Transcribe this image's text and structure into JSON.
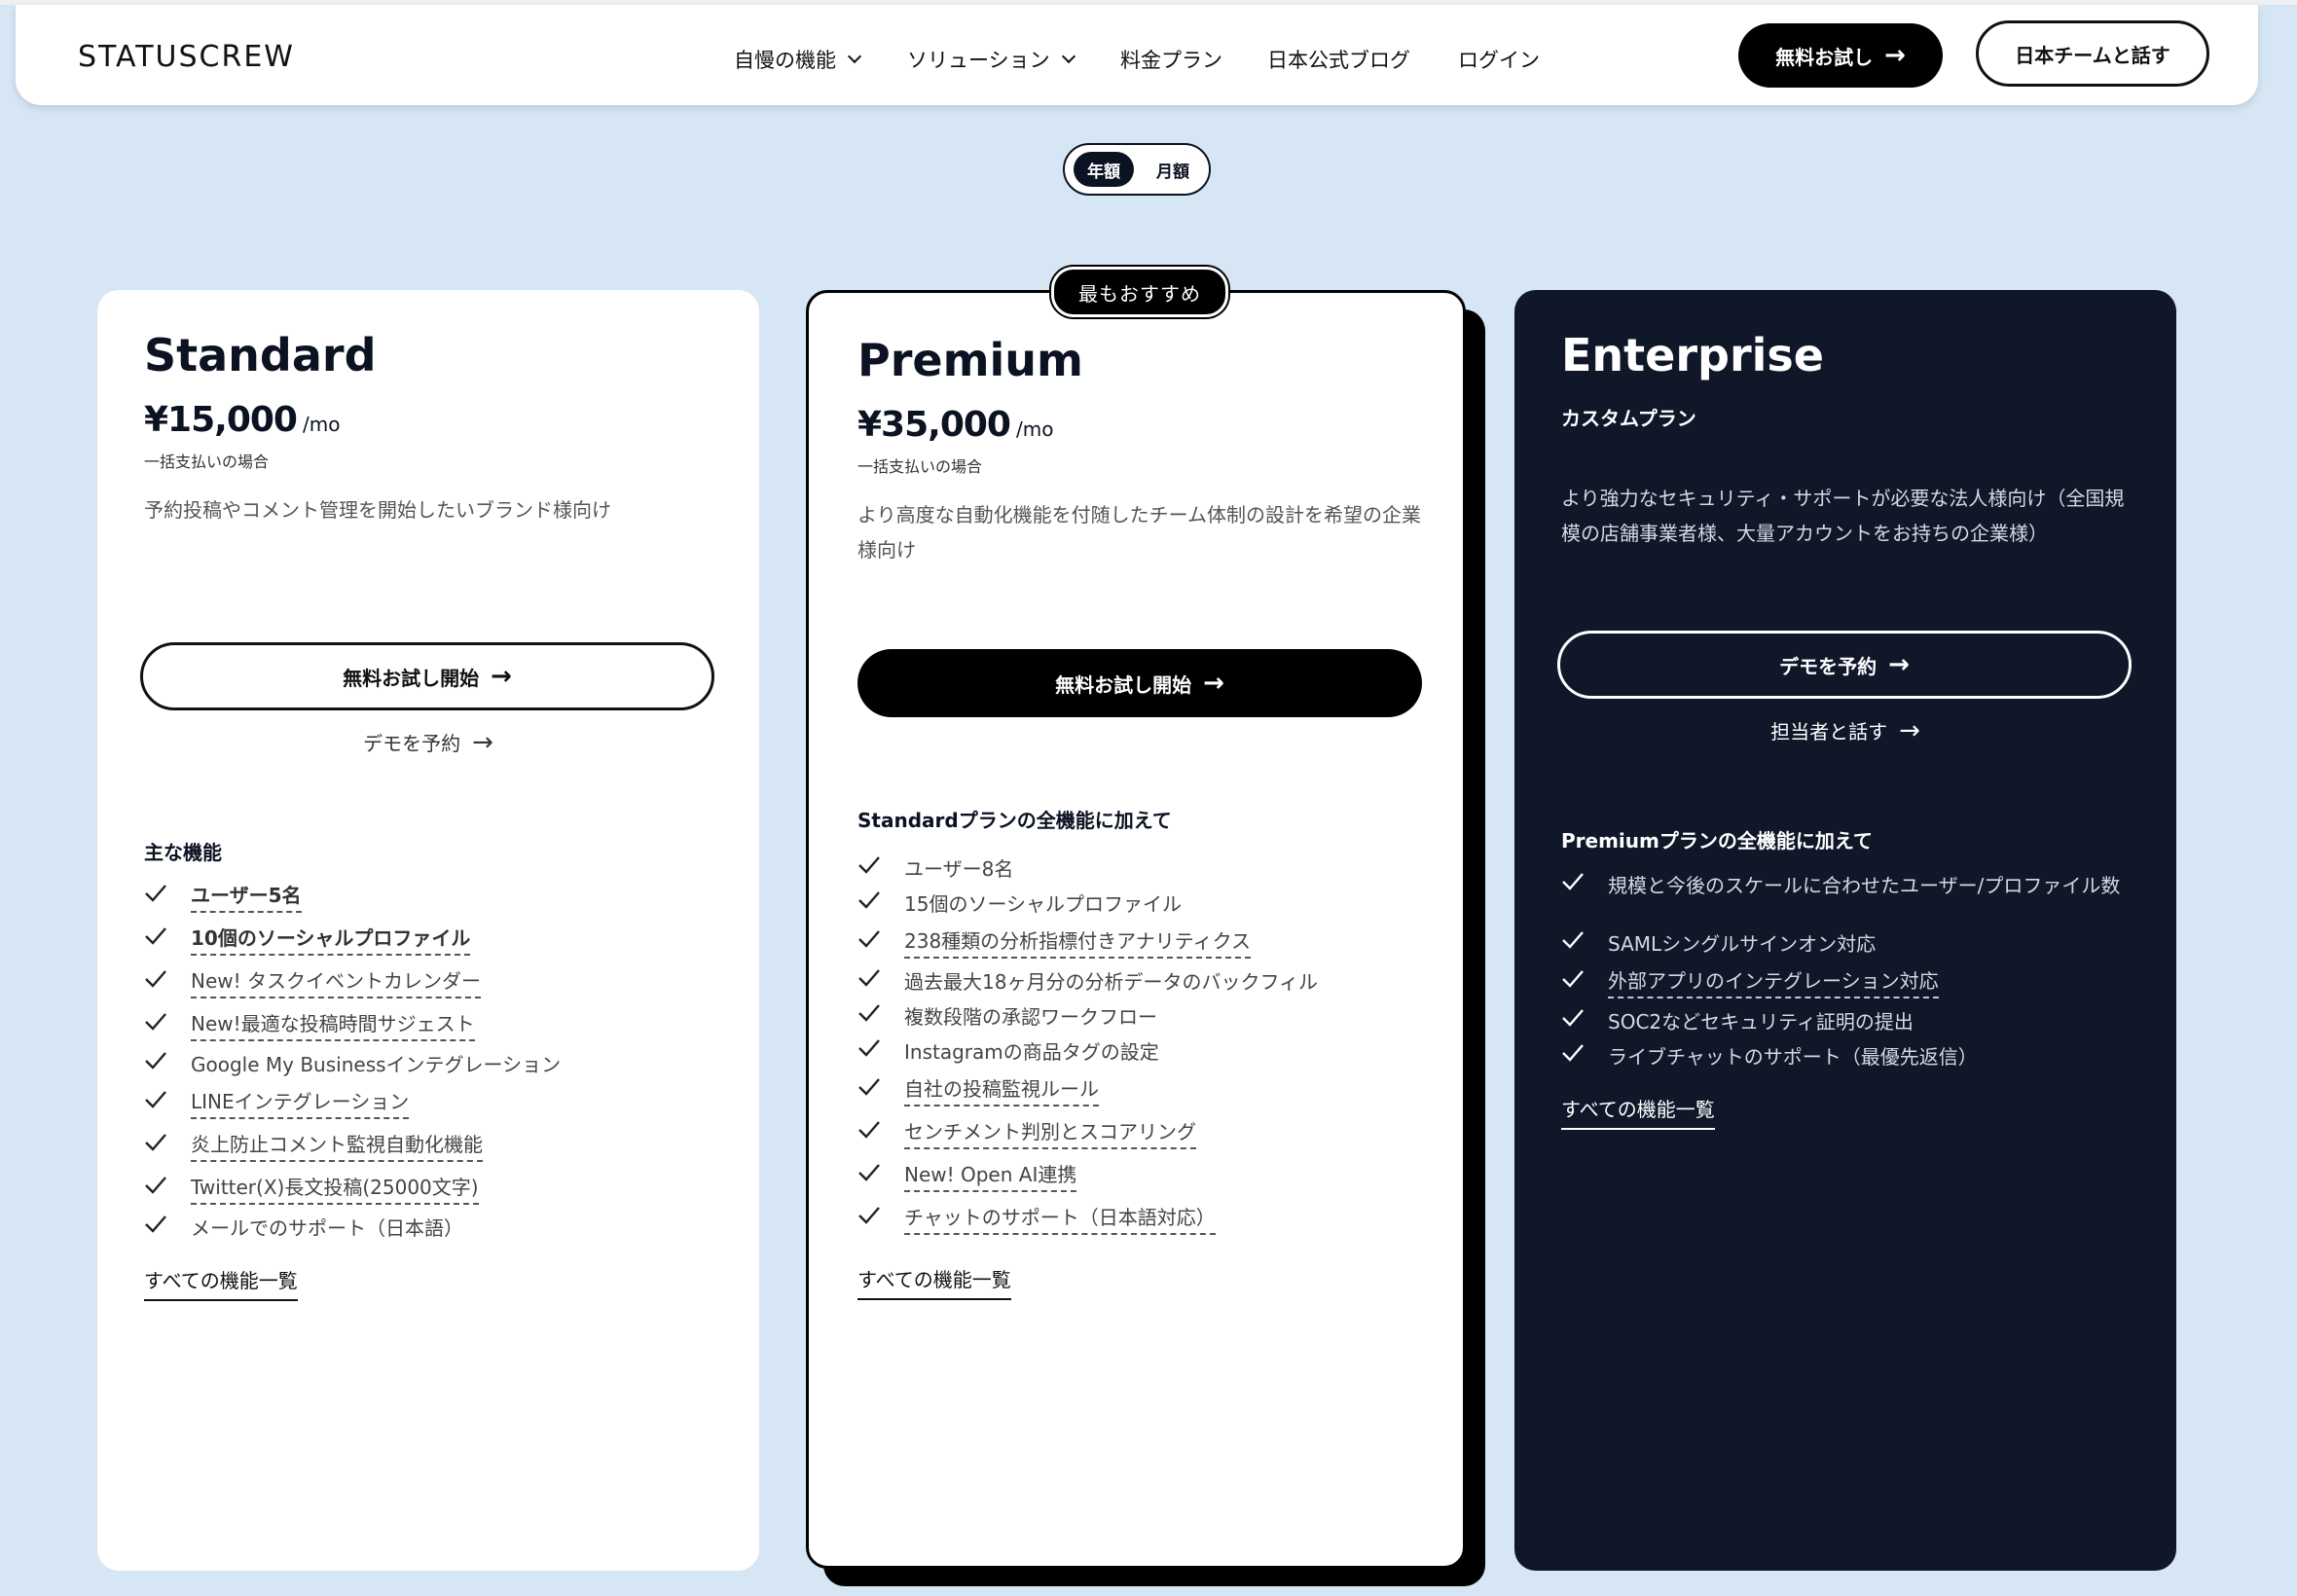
{
  "header": {
    "logo": "STATUSCREW",
    "nav": [
      {
        "label": "自慢の機能",
        "dropdown": true
      },
      {
        "label": "ソリューション",
        "dropdown": true
      },
      {
        "label": "料金プラン",
        "dropdown": false
      },
      {
        "label": "日本公式ブログ",
        "dropdown": false
      },
      {
        "label": "ログイン",
        "dropdown": false
      }
    ],
    "trial_button": "無料お試し",
    "talk_button": "日本チームと話す"
  },
  "billing_toggle": {
    "annual": "年額",
    "monthly": "月額",
    "selected": "年額"
  },
  "recommended_badge": "最もおすすめ",
  "plans": {
    "standard": {
      "name": "Standard",
      "price": "¥15,000",
      "per": "/mo",
      "billing_note": "一括支払いの場合",
      "description": "予約投稿やコメント管理を開始したいブランド様向け",
      "cta": "無料お試し開始",
      "sublink": "デモを予約",
      "features_heading": "主な機能",
      "features": [
        "ユーザー5名",
        "10個のソーシャルプロファイル",
        "New! タスクイベントカレンダー",
        "New!最適な投稿時間サジェスト",
        "Google My Businessインテグレーション",
        "LINEインテグレーション",
        "炎上防止コメント監視自動化機能",
        "Twitter(X)長文投稿(25000文字)",
        "メールでのサポート（日本語）"
      ],
      "all_features": "すべての機能一覧"
    },
    "premium": {
      "name": "Premium",
      "price": "¥35,000",
      "per": "/mo",
      "billing_note": "一括支払いの場合",
      "description": "より高度な自動化機能を付随したチーム体制の設計を希望の企業様向け",
      "cta": "無料お試し開始",
      "features_heading": "Standardプランの全機能に加えて",
      "features": [
        "ユーザー8名",
        "15個のソーシャルプロファイル",
        "238種類の分析指標付きアナリティクス",
        "過去最大18ヶ月分の分析データのバックフィル",
        "複数段階の承認ワークフロー",
        "Instagramの商品タグの設定",
        "自社の投稿監視ルール",
        "センチメント判別とスコアリング",
        "New! Open AI連携",
        "チャットのサポート（日本語対応）"
      ],
      "all_features": "すべての機能一覧"
    },
    "enterprise": {
      "name": "Enterprise",
      "subtitle": "カスタムプラン",
      "description": "より強力なセキュリティ・サポートが必要な法人様向け（全国規模の店舗事業者様、大量アカウントをお持ちの企業様）",
      "cta": "デモを予約",
      "sublink": "担当者と話す",
      "features_heading": "Premiumプランの全機能に加えて",
      "features": [
        "規模と今後のスケールに合わせたユーザー/プロファイル数",
        "SAMLシングルサインオン対応",
        "外部アプリのインテグレーション対応",
        "SOC2などセキュリティ証明の提出",
        "ライブチャットのサポート（最優先返信）"
      ],
      "all_features": "すべての機能一覧"
    }
  },
  "colors": {
    "page_bg": "#d6e6f4",
    "navy": "#0f1729",
    "black": "#000000"
  }
}
